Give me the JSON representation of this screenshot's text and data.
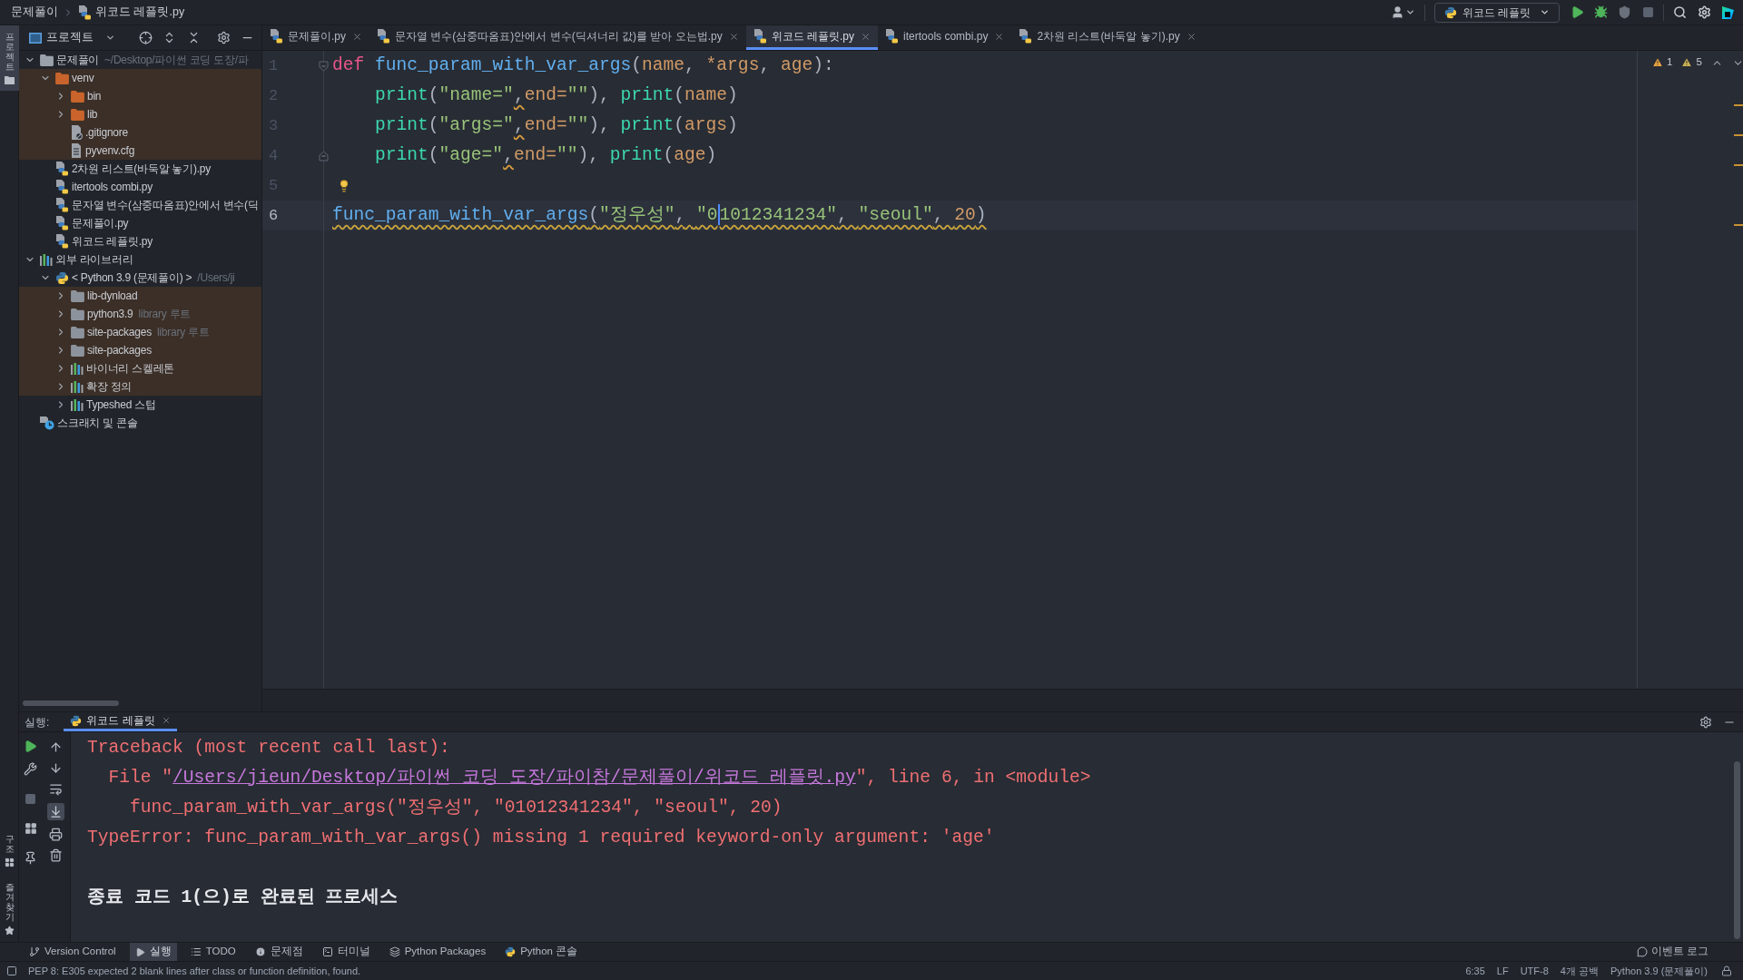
{
  "title_bar": {
    "breadcrumbs": [
      "문제풀이",
      "위코드 레플릿.py"
    ],
    "run_config": "위코드 레플릿"
  },
  "left_strip": {
    "top": [
      {
        "label": "프로젝트",
        "kind": "project",
        "selected": true
      }
    ],
    "bottom": [
      {
        "label": "구조",
        "kind": "structure",
        "selected": false
      },
      {
        "label": "즐겨찾기",
        "kind": "favorites",
        "selected": false
      }
    ]
  },
  "project_panel": {
    "title": "프로젝트",
    "tree": [
      {
        "label": "문제풀이",
        "kind": "module",
        "expanded": true,
        "shaded": false,
        "hint": "~/Desktop/파이썬 코딩 도장/파",
        "children": [
          {
            "label": "venv",
            "kind": "excluded",
            "expanded": true,
            "shaded": true,
            "children": [
              {
                "label": "bin",
                "kind": "excluded",
                "expanded": false,
                "shaded": true
              },
              {
                "label": "lib",
                "kind": "excluded",
                "expanded": false,
                "shaded": true
              },
              {
                "label": ".gitignore",
                "kind": "ignore",
                "shaded": true
              },
              {
                "label": "pyvenv.cfg",
                "kind": "text",
                "shaded": true
              }
            ]
          },
          {
            "label": "2차원 리스트(바둑알 놓기).py",
            "kind": "python",
            "shaded": false
          },
          {
            "label": "itertools combi.py",
            "kind": "python",
            "shaded": false
          },
          {
            "label": "문자열 변수(삼중따옴표)안에서 변수(딕",
            "kind": "python",
            "shaded": false
          },
          {
            "label": "문제풀이.py",
            "kind": "python",
            "shaded": false
          },
          {
            "label": "위코드 레플릿.py",
            "kind": "python",
            "shaded": false
          }
        ]
      },
      {
        "label": "외부 라이브러리",
        "kind": "libraries",
        "expanded": true,
        "shaded": false,
        "children": [
          {
            "label": "< Python 3.9 (문제풀이) >",
            "kind": "sdk",
            "expanded": true,
            "shaded": false,
            "hint": "/Users/ji",
            "children": [
              {
                "label": "lib-dynload",
                "kind": "folder",
                "expanded": false,
                "shaded": true
              },
              {
                "label": "python3.9",
                "kind": "folder",
                "expanded": false,
                "shaded": true,
                "hint": "library 루트"
              },
              {
                "label": "site-packages",
                "kind": "folder",
                "expanded": false,
                "shaded": true,
                "hint": "library 루트"
              },
              {
                "label": "site-packages",
                "kind": "folder",
                "expanded": false,
                "shaded": true
              },
              {
                "label": "바이너리 스켈레톤",
                "kind": "library",
                "expanded": false,
                "shaded": true
              },
              {
                "label": "확장 정의",
                "kind": "library",
                "expanded": false,
                "shaded": true
              },
              {
                "label": "Typeshed 스텁",
                "kind": "library",
                "expanded": false,
                "shaded": false
              }
            ]
          }
        ]
      },
      {
        "label": "스크래치 및 콘솔",
        "kind": "scratches",
        "shaded": false
      }
    ]
  },
  "editor": {
    "tabs": [
      {
        "label": "문제풀이.py",
        "selected": false
      },
      {
        "label": "문자열 변수(삼중따옴표)안에서 변수(딕셔너리 값)를 받아 오는법.py",
        "selected": false
      },
      {
        "label": "위코드 레플릿.py",
        "selected": true
      },
      {
        "label": "itertools combi.py",
        "selected": false
      },
      {
        "label": "2차원 리스트(바둑알 놓기).py",
        "selected": false
      }
    ],
    "inspections": [
      {
        "kind": "warning",
        "count": "1"
      },
      {
        "kind": "weak_warning",
        "count": "5"
      }
    ],
    "lines": [
      {
        "number": "1",
        "current": false,
        "warned": false,
        "intention": false,
        "expanded": true,
        "tokens": [
          {
            "kind": "keyword",
            "text": "def "
          },
          {
            "kind": "function",
            "text": "func_param_with_var_args"
          },
          {
            "kind": "punct",
            "text": "("
          },
          {
            "kind": "param",
            "text": "name"
          },
          {
            "kind": "punct",
            "text": ", "
          },
          {
            "kind": "param",
            "text": "*args"
          },
          {
            "kind": "punct",
            "text": ", "
          },
          {
            "kind": "param",
            "text": "age"
          },
          {
            "kind": "punct",
            "text": "):"
          }
        ],
        "children": [
          {
            "number": "2",
            "current": false,
            "warned": false,
            "intention": false,
            "tokens": [
              {
                "kind": "builtin",
                "text": "print"
              },
              {
                "kind": "punct",
                "text": "("
              },
              {
                "kind": "string",
                "text": "\"name=\""
              },
              {
                "kind": "flagged",
                "text": ","
              },
              {
                "kind": "kwarg",
                "text": "end="
              },
              {
                "kind": "string",
                "text": "\"\""
              },
              {
                "kind": "punct",
                "text": "), "
              },
              {
                "kind": "builtin",
                "text": "print"
              },
              {
                "kind": "punct",
                "text": "("
              },
              {
                "kind": "param",
                "text": "name"
              },
              {
                "kind": "punct",
                "text": ")"
              }
            ]
          },
          {
            "number": "3",
            "current": false,
            "warned": false,
            "intention": false,
            "tokens": [
              {
                "kind": "builtin",
                "text": "print"
              },
              {
                "kind": "punct",
                "text": "("
              },
              {
                "kind": "string",
                "text": "\"args=\""
              },
              {
                "kind": "flagged",
                "text": ","
              },
              {
                "kind": "kwarg",
                "text": "end="
              },
              {
                "kind": "string",
                "text": "\"\""
              },
              {
                "kind": "punct",
                "text": "), "
              },
              {
                "kind": "builtin",
                "text": "print"
              },
              {
                "kind": "punct",
                "text": "("
              },
              {
                "kind": "param",
                "text": "args"
              },
              {
                "kind": "punct",
                "text": ")"
              }
            ]
          },
          {
            "number": "4",
            "current": false,
            "warned": false,
            "intention": false,
            "tokens": [
              {
                "kind": "builtin",
                "text": "print"
              },
              {
                "kind": "punct",
                "text": "("
              },
              {
                "kind": "string",
                "text": "\"age=\""
              },
              {
                "kind": "flagged",
                "text": ","
              },
              {
                "kind": "kwarg",
                "text": "end="
              },
              {
                "kind": "string",
                "text": "\"\""
              },
              {
                "kind": "punct",
                "text": "), "
              },
              {
                "kind": "builtin",
                "text": "print"
              },
              {
                "kind": "punct",
                "text": "("
              },
              {
                "kind": "param",
                "text": "age"
              },
              {
                "kind": "punct",
                "text": ")"
              }
            ]
          }
        ]
      },
      {
        "number": "5",
        "current": false,
        "warned": false,
        "intention": true
      },
      {
        "number": "6",
        "current": true,
        "warned": true,
        "intention": false,
        "tokens": [
          {
            "kind": "call",
            "text": "func_param_with_var_args"
          },
          {
            "kind": "punct",
            "text": "("
          },
          {
            "kind": "string",
            "text": "\"정우성\""
          },
          {
            "kind": "punct",
            "text": ", "
          },
          {
            "kind": "string",
            "text": "\"0"
          },
          {
            "kind": "caret"
          },
          {
            "kind": "string",
            "text": "1012341234\""
          },
          {
            "kind": "punct",
            "text": ", "
          },
          {
            "kind": "string",
            "text": "\"seoul\""
          },
          {
            "kind": "punct",
            "text": ", "
          },
          {
            "kind": "number",
            "text": "20"
          },
          {
            "kind": "punct",
            "text": ")"
          }
        ]
      }
    ]
  },
  "run_panel": {
    "label": "실행:",
    "tabs": [
      {
        "label": "위코드 레플릿",
        "selected": true
      }
    ],
    "scroll_to_end": true,
    "output": [
      {
        "kind": "header",
        "parts": [
          {
            "kind": "text",
            "text": "Traceback (most recent call last):"
          }
        ]
      },
      {
        "kind": "frame",
        "parts": [
          {
            "kind": "text",
            "text": "File \""
          },
          {
            "kind": "link",
            "text": "/Users/jieun/Desktop/파이썬 코딩 도장/파이참/문제풀이/위코드 레플릿.py"
          },
          {
            "kind": "text",
            "text": "\", line 6, in <module>"
          }
        ]
      },
      {
        "kind": "source",
        "parts": [
          {
            "kind": "text",
            "text": "func_param_with_var_args(\"정우성\", \"01012341234\", \"seoul\", 20)"
          }
        ]
      },
      {
        "kind": "error",
        "parts": [
          {
            "kind": "text",
            "text": "TypeError: func_param_with_var_args() missing 1 required keyword-only argument: 'age'"
          }
        ]
      },
      {
        "kind": "exit",
        "parts": [
          {
            "kind": "text",
            "text": "종료 코드 1(으)로 완료된 프로세스"
          }
        ]
      }
    ]
  },
  "tool_windows": [
    {
      "label": "Version Control",
      "kind": "vcs",
      "selected": false
    },
    {
      "label": "실행",
      "kind": "run",
      "selected": true
    },
    {
      "label": "TODO",
      "kind": "todo",
      "selected": false
    },
    {
      "label": "문제점",
      "kind": "problems",
      "selected": false
    },
    {
      "label": "터미널",
      "kind": "terminal",
      "selected": false
    },
    {
      "label": "Python Packages",
      "kind": "packages",
      "selected": false
    },
    {
      "label": "Python 콘솔",
      "kind": "console",
      "selected": false
    }
  ],
  "event_log": "이벤트 로그",
  "status_bar": {
    "message": "PEP 8: E305 expected 2 blank lines after class or function definition, found.",
    "items": [
      "6:35",
      "LF",
      "UTF-8",
      "4개 공백",
      "Python 3.9 (문제풀이)"
    ]
  }
}
